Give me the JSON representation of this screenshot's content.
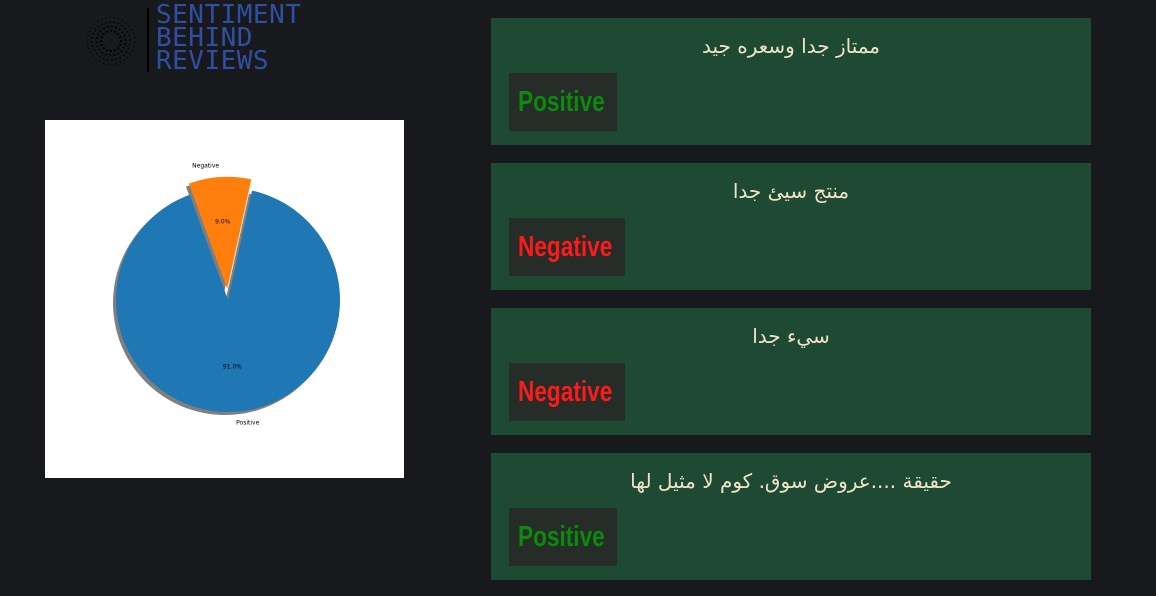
{
  "logo": {
    "lines": [
      "SENTIMENT",
      "BEHIND",
      "REVIEWS"
    ]
  },
  "chart_data": {
    "type": "pie",
    "categories": [
      "Positive",
      "Negative"
    ],
    "values": [
      91.0,
      9.0
    ],
    "labels": [
      "91.0%",
      "9.0%"
    ],
    "colors": [
      "#1f77b4",
      "#ff7f0e"
    ],
    "explode": [
      false,
      true
    ],
    "shadow": true,
    "title": ""
  },
  "reviews": [
    {
      "text": "ممتاز جدا وسعره جيد",
      "sentiment": "Positive",
      "color": "#0b8a0b"
    },
    {
      "text": "منتج سيئ جدا",
      "sentiment": "Negative",
      "color": "#ff1a1a"
    },
    {
      "text": "سيء جدا",
      "sentiment": "Negative",
      "color": "#ff1a1a"
    },
    {
      "text": "حقيقة ....عروض سوق. كوم لا مثيل لها",
      "sentiment": "Positive",
      "color": "#0b8a0b"
    }
  ]
}
